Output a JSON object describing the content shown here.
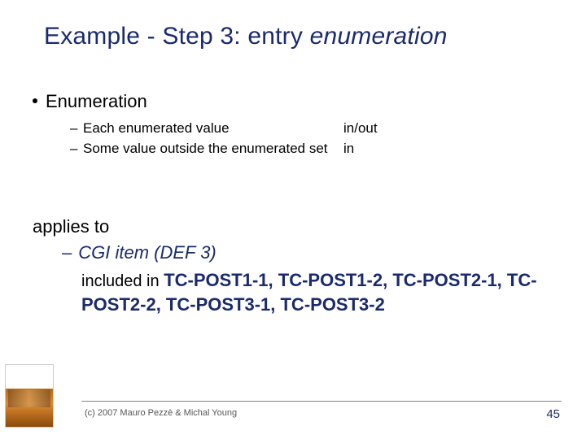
{
  "title": {
    "prefix": "Example - Step 3: entry ",
    "emph": "enumeration"
  },
  "bullet": {
    "label": "Enumeration",
    "subs": [
      {
        "text": "Each enumerated value",
        "tag": "in/out"
      },
      {
        "text": "Some value outside the enumerated set",
        "tag": "in"
      }
    ]
  },
  "applies": {
    "heading": "applies to",
    "cgi": "CGI item (DEF 3)",
    "included_lead": "included in ",
    "tc": "TC-POST1-1, TC-POST1-2, TC-POST2-1, TC-POST2-2, TC-POST3-1, TC-POST3-2"
  },
  "footer": {
    "copyright": "(c) 2007 Mauro Pezzè & Michal Young",
    "page": "45"
  }
}
